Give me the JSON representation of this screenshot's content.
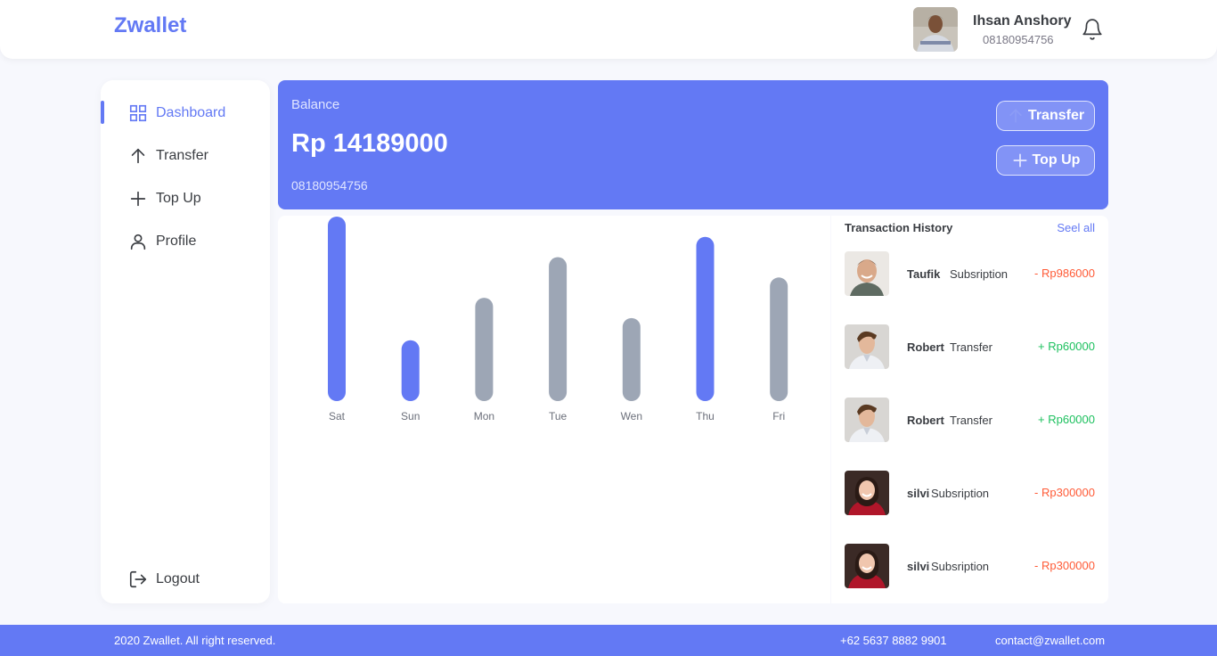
{
  "brand": "Zwallet",
  "user": {
    "name": "Ihsan Anshory",
    "phone": "08180954756"
  },
  "nav": [
    {
      "label": "Dashboard",
      "icon": "grid-icon",
      "active": true
    },
    {
      "label": "Transfer",
      "icon": "arrow-up-icon"
    },
    {
      "label": "Top Up",
      "icon": "plus-icon"
    },
    {
      "label": "Profile",
      "icon": "user-icon"
    }
  ],
  "logout_label": "Logout",
  "balance": {
    "label": "Balance",
    "amount": "Rp 14189000",
    "phone": "08180954756",
    "transfer_label": "Transfer",
    "topup_label": "Top Up"
  },
  "chart_data": {
    "type": "bar",
    "categories": [
      "Sat",
      "Sun",
      "Mon",
      "Tue",
      "Wen",
      "Thu",
      "Fri"
    ],
    "values": [
      100,
      33,
      56,
      78,
      45,
      89,
      67
    ],
    "highlight": [
      true,
      true,
      false,
      false,
      false,
      true,
      false
    ],
    "colors": {
      "highlight": "#6379f4",
      "normal": "#9da6b5"
    }
  },
  "history": {
    "title": "Transaction History",
    "see_all": "Seel all",
    "items": [
      {
        "name": "Taufik",
        "type": "Subsription",
        "amount": "- Rp986000",
        "sign": "neg",
        "avatar": "man-smiling"
      },
      {
        "name": "Robert",
        "type": "Transfer",
        "amount": "+ Rp60000",
        "sign": "pos",
        "avatar": "man-shirt"
      },
      {
        "name": "Robert",
        "type": "Transfer",
        "amount": "+ Rp60000",
        "sign": "pos",
        "avatar": "man-shirt"
      },
      {
        "name": "silvi",
        "type": "Subsription",
        "amount": "- Rp300000",
        "sign": "neg",
        "avatar": "woman-red"
      },
      {
        "name": "silvi",
        "type": "Subsription",
        "amount": "- Rp300000",
        "sign": "neg",
        "avatar": "woman-red"
      }
    ]
  },
  "footer": {
    "copyright": "2020 Zwallet. All right reserved.",
    "phone": "+62 5637 8882 9901",
    "email": "contact@zwallet.com"
  }
}
